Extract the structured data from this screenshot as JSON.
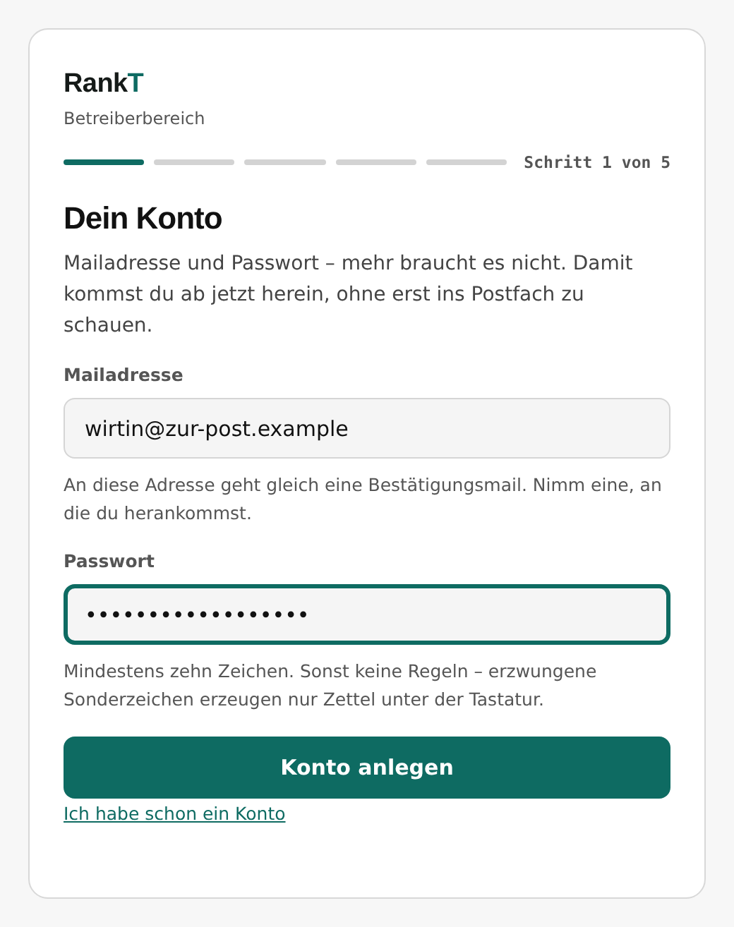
{
  "brand": {
    "name": "Rank",
    "accent": "T",
    "subtitle": "Betreiberbereich"
  },
  "progress": {
    "steps": [
      {
        "done": true
      },
      {
        "done": false
      },
      {
        "done": false
      },
      {
        "done": false
      },
      {
        "done": false
      }
    ],
    "label": "Schritt 1 von 5"
  },
  "heading": "Dein Konto",
  "intro": "Mailadresse und Passwort – mehr braucht es nicht. Damit kommst du ab jetzt herein, ohne erst ins Postfach zu schauen.",
  "fields": [
    {
      "label": "Mailadresse",
      "value": "wirtin@zur-post.example",
      "focused": false,
      "hint": "An diese Adresse geht gleich eine Bestätigungsmail. Nimm eine, an die du herankommst."
    },
    {
      "label": "Passwort",
      "value": "••••••••••••••••••",
      "focused": true,
      "hint": "Mindestens zehn Zeichen. Sonst keine Regeln – erzwungene Sonderzeichen erzeugen nur Zettel unter der Tastatur."
    }
  ],
  "submit": "Konto anlegen",
  "login_link": "Ich habe schon ein Konto"
}
